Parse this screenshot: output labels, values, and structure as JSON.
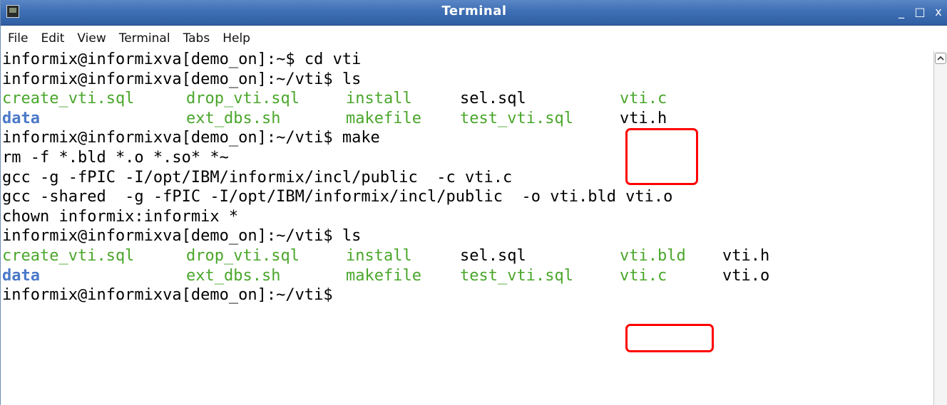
{
  "window": {
    "title": "Terminal",
    "minimize_glyph": "_",
    "maximize_glyph": "□",
    "close_glyph": "x"
  },
  "menu": [
    "File",
    "Edit",
    "View",
    "Terminal",
    "Tabs",
    "Help"
  ],
  "terminal": {
    "lines": [
      [
        {
          "t": "informix@informixva[demo_on]:~$ cd vti",
          "c": "black"
        }
      ],
      [
        {
          "t": "informix@informixva[demo_on]:~/vti$ ls",
          "c": "black"
        }
      ],
      [
        {
          "t": "create_vti.sql",
          "c": "green"
        },
        {
          "t": "drop_vti.sql",
          "c": "green"
        },
        {
          "t": "install",
          "c": "green"
        },
        {
          "t": "sel.sql",
          "c": "black"
        },
        {
          "t": "vti.c",
          "c": "green"
        }
      ],
      [
        {
          "t": "data",
          "c": "blue"
        },
        {
          "t": "ext_dbs.sh",
          "c": "green"
        },
        {
          "t": "makefile",
          "c": "green"
        },
        {
          "t": "test_vti.sql",
          "c": "green"
        },
        {
          "t": "vti.h",
          "c": "black"
        }
      ],
      [
        {
          "t": "informix@informixva[demo_on]:~/vti$ make",
          "c": "black"
        }
      ],
      [
        {
          "t": "rm -f *.bld *.o *.so* *~",
          "c": "black"
        }
      ],
      [
        {
          "t": "gcc -g -fPIC -I/opt/IBM/informix/incl/public  -c vti.c",
          "c": "black"
        }
      ],
      [
        {
          "t": "gcc -shared  -g -fPIC -I/opt/IBM/informix/incl/public  -o vti.bld vti.o",
          "c": "black"
        }
      ],
      [
        {
          "t": "chown informix:informix *",
          "c": "black"
        }
      ],
      [
        {
          "t": "informix@informixva[demo_on]:~/vti$ ls",
          "c": "black"
        }
      ],
      [
        {
          "t": "create_vti.sql",
          "c": "green"
        },
        {
          "t": "drop_vti.sql",
          "c": "green"
        },
        {
          "t": "install",
          "c": "green"
        },
        {
          "t": "sel.sql",
          "c": "black"
        },
        {
          "t": "vti.bld",
          "c": "green"
        },
        {
          "t": "vti.h",
          "c": "black"
        }
      ],
      [
        {
          "t": "data",
          "c": "blue"
        },
        {
          "t": "ext_dbs.sh",
          "c": "green"
        },
        {
          "t": "makefile",
          "c": "green"
        },
        {
          "t": "test_vti.sql",
          "c": "green"
        },
        {
          "t": "vti.c",
          "c": "green"
        },
        {
          "t": "vti.o",
          "c": "black"
        }
      ],
      [
        {
          "t": "informix@informixva[demo_on]:~/vti$",
          "c": "black"
        }
      ]
    ]
  },
  "colors": {
    "green": "#4aa62b",
    "blue": "#4a78c8",
    "highlight": "#ff0000",
    "titlebar": "#3f6fb4"
  }
}
